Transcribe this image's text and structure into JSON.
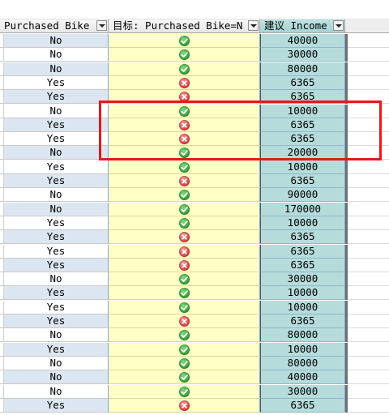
{
  "columns": {
    "purchased": {
      "label": "Purchased Bike",
      "filter_icon": "dropdown-arrow-icon"
    },
    "target": {
      "label": "目标: Purchased Bike=N",
      "filter_icon": "dropdown-arrow-icon"
    },
    "income": {
      "label": "建议 Income",
      "filter_icon": "dropdown-arrow-icon"
    }
  },
  "status_icons": {
    "ok": "green-check-circle-icon",
    "bad": "red-x-circle-icon"
  },
  "colors": {
    "row_alt": "#dce6f1",
    "target_column": "#ffffc6",
    "income_column": "#b6dbdb",
    "highlight_border": "#e21a1a"
  },
  "rows": [
    {
      "purchased": "No",
      "status": "ok",
      "income": "40000"
    },
    {
      "purchased": "No",
      "status": "ok",
      "income": "30000"
    },
    {
      "purchased": "No",
      "status": "ok",
      "income": "80000"
    },
    {
      "purchased": "Yes",
      "status": "bad",
      "income": "6365"
    },
    {
      "purchased": "Yes",
      "status": "bad",
      "income": "6365"
    },
    {
      "purchased": "No",
      "status": "ok",
      "income": "10000"
    },
    {
      "purchased": "Yes",
      "status": "bad",
      "income": "6365"
    },
    {
      "purchased": "Yes",
      "status": "bad",
      "income": "6365"
    },
    {
      "purchased": "No",
      "status": "ok",
      "income": "20000"
    },
    {
      "purchased": "Yes",
      "status": "ok",
      "income": "10000"
    },
    {
      "purchased": "Yes",
      "status": "bad",
      "income": "6365"
    },
    {
      "purchased": "No",
      "status": "ok",
      "income": "90000"
    },
    {
      "purchased": "No",
      "status": "ok",
      "income": "170000"
    },
    {
      "purchased": "Yes",
      "status": "ok",
      "income": "10000"
    },
    {
      "purchased": "Yes",
      "status": "bad",
      "income": "6365"
    },
    {
      "purchased": "Yes",
      "status": "bad",
      "income": "6365"
    },
    {
      "purchased": "Yes",
      "status": "bad",
      "income": "6365"
    },
    {
      "purchased": "No",
      "status": "ok",
      "income": "30000"
    },
    {
      "purchased": "Yes",
      "status": "ok",
      "income": "10000"
    },
    {
      "purchased": "Yes",
      "status": "ok",
      "income": "10000"
    },
    {
      "purchased": "Yes",
      "status": "bad",
      "income": "6365"
    },
    {
      "purchased": "No",
      "status": "ok",
      "income": "80000"
    },
    {
      "purchased": "Yes",
      "status": "ok",
      "income": "10000"
    },
    {
      "purchased": "No",
      "status": "ok",
      "income": "80000"
    },
    {
      "purchased": "No",
      "status": "ok",
      "income": "40000"
    },
    {
      "purchased": "No",
      "status": "ok",
      "income": "30000"
    },
    {
      "purchased": "Yes",
      "status": "bad",
      "income": "6365"
    }
  ]
}
